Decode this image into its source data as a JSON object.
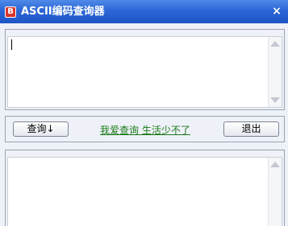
{
  "window": {
    "title": "ASCII编码查询器",
    "app_icon_glyph": "B",
    "close_glyph": "×"
  },
  "input_area": {
    "value": ""
  },
  "toolbar": {
    "query_button_label": "查询↓",
    "link_text": "我爱查询 生活少不了",
    "exit_button_label": "退出"
  },
  "output_area": {
    "value": ""
  },
  "icons": {
    "scroll_up": "scroll-up-arrow-icon",
    "scroll_down": "scroll-down-arrow-icon"
  },
  "colors": {
    "titlebar": "#2b66d6",
    "link": "#1a7a1a",
    "app_icon": "#d9352b"
  }
}
